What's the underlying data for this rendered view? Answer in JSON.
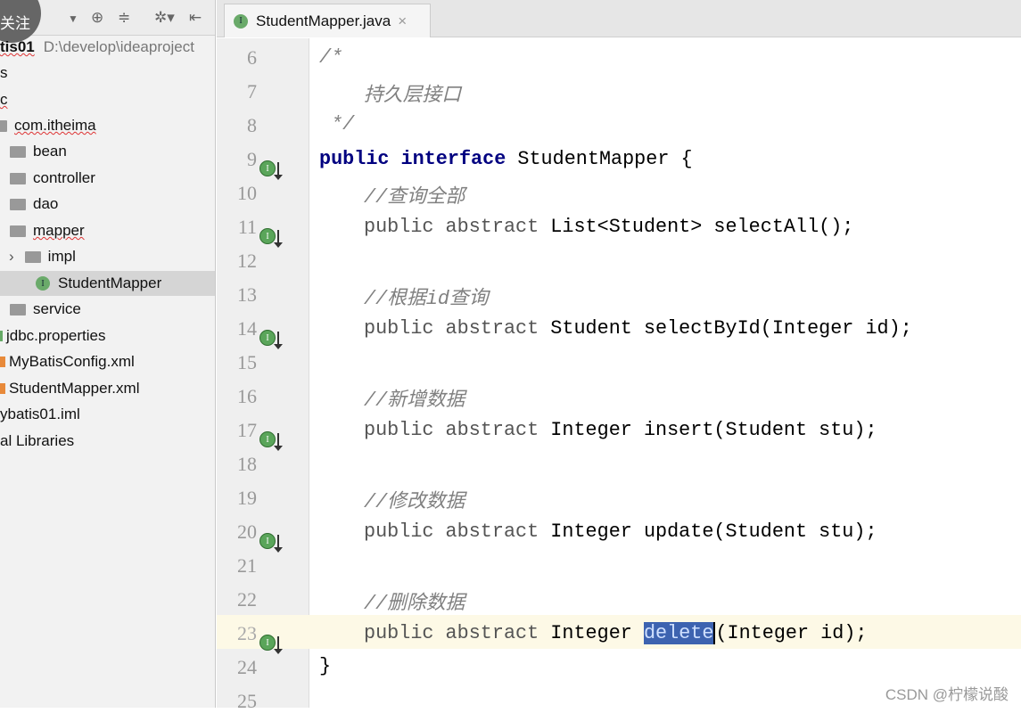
{
  "sidebar": {
    "follow_badge": "关注",
    "project_name": "tis01",
    "project_path": "D:\\develop\\ideaproject",
    "items": [
      "s",
      "c",
      "com.itheima",
      "bean",
      "controller",
      "dao",
      "mapper",
      "impl",
      "StudentMapper",
      "service",
      "jdbc.properties",
      "MyBatisConfig.xml",
      "StudentMapper.xml",
      "ybatis01.iml",
      "al Libraries"
    ]
  },
  "tab": {
    "label": "StudentMapper.java",
    "close": "×"
  },
  "editor": {
    "line_numbers": [
      "6",
      "7",
      "8",
      "9",
      "10",
      "11",
      "12",
      "13",
      "14",
      "15",
      "16",
      "17",
      "18",
      "19",
      "20",
      "21",
      "22",
      "23",
      "24",
      "25"
    ],
    "comment_open": "/*",
    "comment_text": "持久层接口",
    "comment_close": " */",
    "iface_kw": "public interface",
    "iface_name": " StudentMapper {",
    "c1": "//查询全部",
    "c2": "//根据id查询",
    "c3": "//新增数据",
    "c4": "//修改数据",
    "c5": "//删除数据",
    "mod": "public abstract",
    "m1": " List<Student> selectAll();",
    "m2": " Student selectById(Integer id);",
    "m3": " Integer insert(Student stu);",
    "m4": " Integer update(Student stu);",
    "m5_pre": " Integer ",
    "m5_sel": "delete",
    "m5_post": "(Integer id);",
    "close": "}",
    "current_line": "23"
  },
  "watermark": "CSDN @柠檬说酸"
}
